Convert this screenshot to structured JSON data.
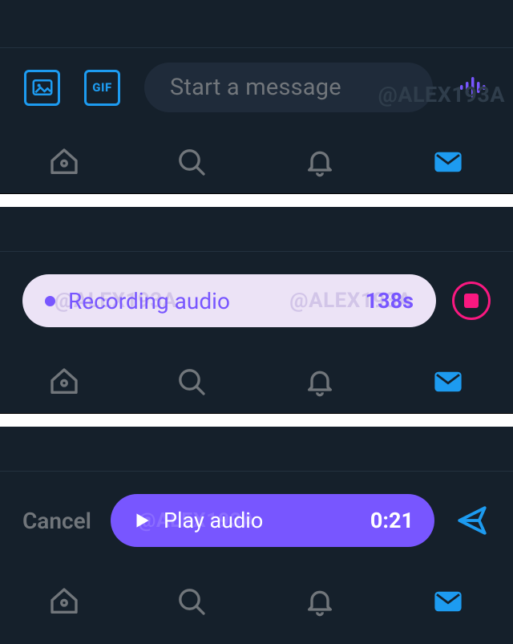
{
  "watermark": "@ALEX193A",
  "compose": {
    "placeholder": "Start a message",
    "gif_label": "GIF"
  },
  "recording": {
    "label": "Recording audio",
    "duration": "138s"
  },
  "playback": {
    "cancel": "Cancel",
    "label": "Play audio",
    "time": "0:21"
  },
  "nav": {
    "home": "home",
    "search": "search",
    "notifications": "notifications",
    "messages": "messages"
  }
}
